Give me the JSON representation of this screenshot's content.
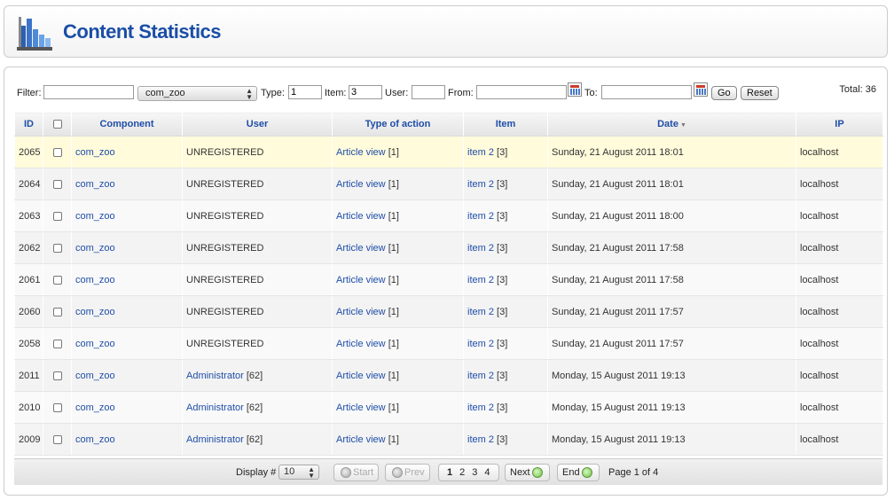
{
  "header": {
    "title": "Content Statistics"
  },
  "filter": {
    "filter_label": "Filter:",
    "filter_value": "",
    "component_select": "com_zoo",
    "type_label": "Type:",
    "type_value": "1",
    "item_label": "Item:",
    "item_value": "3",
    "user_label": "User:",
    "user_value": "",
    "from_label": "From:",
    "from_value": "",
    "to_label": "To:",
    "to_value": "",
    "go_label": "Go",
    "reset_label": "Reset",
    "total_label": "Total: 36"
  },
  "table": {
    "headers": {
      "id": "ID",
      "component": "Component",
      "user": "User",
      "type": "Type of action",
      "item": "Item",
      "date": "Date",
      "ip": "IP"
    },
    "rows": [
      {
        "id": "2065",
        "component": "com_zoo",
        "user": "UNREGISTERED",
        "user_link": false,
        "user_id": "",
        "type": "Article view",
        "type_id": "[1]",
        "item": "item 2",
        "item_id": "[3]",
        "date": "Sunday, 21 August 2011 18:01",
        "ip": "localhost"
      },
      {
        "id": "2064",
        "component": "com_zoo",
        "user": "UNREGISTERED",
        "user_link": false,
        "user_id": "",
        "type": "Article view",
        "type_id": "[1]",
        "item": "item 2",
        "item_id": "[3]",
        "date": "Sunday, 21 August 2011 18:01",
        "ip": "localhost"
      },
      {
        "id": "2063",
        "component": "com_zoo",
        "user": "UNREGISTERED",
        "user_link": false,
        "user_id": "",
        "type": "Article view",
        "type_id": "[1]",
        "item": "item 2",
        "item_id": "[3]",
        "date": "Sunday, 21 August 2011 18:00",
        "ip": "localhost"
      },
      {
        "id": "2062",
        "component": "com_zoo",
        "user": "UNREGISTERED",
        "user_link": false,
        "user_id": "",
        "type": "Article view",
        "type_id": "[1]",
        "item": "item 2",
        "item_id": "[3]",
        "date": "Sunday, 21 August 2011 17:58",
        "ip": "localhost"
      },
      {
        "id": "2061",
        "component": "com_zoo",
        "user": "UNREGISTERED",
        "user_link": false,
        "user_id": "",
        "type": "Article view",
        "type_id": "[1]",
        "item": "item 2",
        "item_id": "[3]",
        "date": "Sunday, 21 August 2011 17:58",
        "ip": "localhost"
      },
      {
        "id": "2060",
        "component": "com_zoo",
        "user": "UNREGISTERED",
        "user_link": false,
        "user_id": "",
        "type": "Article view",
        "type_id": "[1]",
        "item": "item 2",
        "item_id": "[3]",
        "date": "Sunday, 21 August 2011 17:57",
        "ip": "localhost"
      },
      {
        "id": "2058",
        "component": "com_zoo",
        "user": "UNREGISTERED",
        "user_link": false,
        "user_id": "",
        "type": "Article view",
        "type_id": "[1]",
        "item": "item 2",
        "item_id": "[3]",
        "date": "Sunday, 21 August 2011 17:57",
        "ip": "localhost"
      },
      {
        "id": "2011",
        "component": "com_zoo",
        "user": "Administrator",
        "user_link": true,
        "user_id": "[62]",
        "type": "Article view",
        "type_id": "[1]",
        "item": "item 2",
        "item_id": "[3]",
        "date": "Monday, 15 August 2011 19:13",
        "ip": "localhost"
      },
      {
        "id": "2010",
        "component": "com_zoo",
        "user": "Administrator",
        "user_link": true,
        "user_id": "[62]",
        "type": "Article view",
        "type_id": "[1]",
        "item": "item 2",
        "item_id": "[3]",
        "date": "Monday, 15 August 2011 19:13",
        "ip": "localhost"
      },
      {
        "id": "2009",
        "component": "com_zoo",
        "user": "Administrator",
        "user_link": true,
        "user_id": "[62]",
        "type": "Article view",
        "type_id": "[1]",
        "item": "item 2",
        "item_id": "[3]",
        "date": "Monday, 15 August 2011 19:13",
        "ip": "localhost"
      }
    ]
  },
  "pagination": {
    "display_label": "Display #",
    "display_value": "10",
    "start": "Start",
    "prev": "Prev",
    "pages": [
      "1",
      "2",
      "3",
      "4"
    ],
    "next": "Next",
    "end": "End",
    "page_info": "Page 1 of 4"
  },
  "colors": {
    "link": "#1f4ea8",
    "highlight_row": "#fffbdb"
  }
}
